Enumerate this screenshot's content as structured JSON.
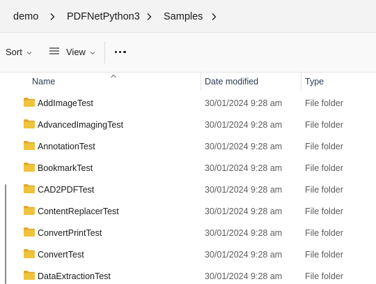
{
  "breadcrumb": {
    "items": [
      "demo",
      "PDFNetPython3",
      "Samples"
    ]
  },
  "commandbar": {
    "sort_label": "Sort",
    "view_label": "View",
    "more_icon": "ellipsis-icon"
  },
  "columns": {
    "name": "Name",
    "date_modified": "Date modified",
    "type": "Type"
  },
  "files": [
    {
      "name": "AddImageTest",
      "date": "30/01/2024 9:28 am",
      "type": "File folder"
    },
    {
      "name": "AdvancedImagingTest",
      "date": "30/01/2024 9:28 am",
      "type": "File folder"
    },
    {
      "name": "AnnotationTest",
      "date": "30/01/2024 9:28 am",
      "type": "File folder"
    },
    {
      "name": "BookmarkTest",
      "date": "30/01/2024 9:28 am",
      "type": "File folder"
    },
    {
      "name": "CAD2PDFTest",
      "date": "30/01/2024 9:28 am",
      "type": "File folder"
    },
    {
      "name": "ContentReplacerTest",
      "date": "30/01/2024 9:28 am",
      "type": "File folder"
    },
    {
      "name": "ConvertPrintTest",
      "date": "30/01/2024 9:28 am",
      "type": "File folder"
    },
    {
      "name": "ConvertTest",
      "date": "30/01/2024 9:28 am",
      "type": "File folder"
    },
    {
      "name": "DataExtractionTest",
      "date": "30/01/2024 9:28 am",
      "type": "File folder"
    }
  ],
  "colors": {
    "folder_yellow": "#f0c33c",
    "folder_back": "#e0a82e",
    "header_text": "#2b3b52"
  }
}
